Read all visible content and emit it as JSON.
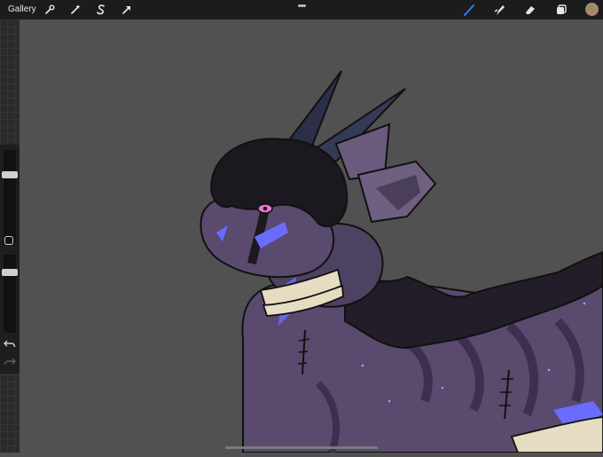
{
  "topbar": {
    "gallery_label": "Gallery",
    "left_tools": [
      "wrench-icon",
      "magic-wand-icon",
      "selection-icon",
      "transform-arrow-icon"
    ],
    "more_label": "•••",
    "right_tools": [
      "brush-icon",
      "smudge-icon",
      "eraser-icon",
      "layers-icon"
    ],
    "active_tool": "brush-icon",
    "active_color": "#a08a6e"
  },
  "sidebar": {
    "brush_size_level": 0.75,
    "opacity_level": 0.25,
    "undo_icon": "undo-icon",
    "redo_icon": "redo-icon"
  },
  "canvas": {
    "background": "#515151",
    "artwork": "dragon-illustration"
  },
  "colors": {
    "topbar": "#1c1c1c",
    "accent": "#2f7cf6",
    "creature_body": "#5a4a6e",
    "glow": "#6a6cff",
    "collar": "#e6dcc2"
  }
}
